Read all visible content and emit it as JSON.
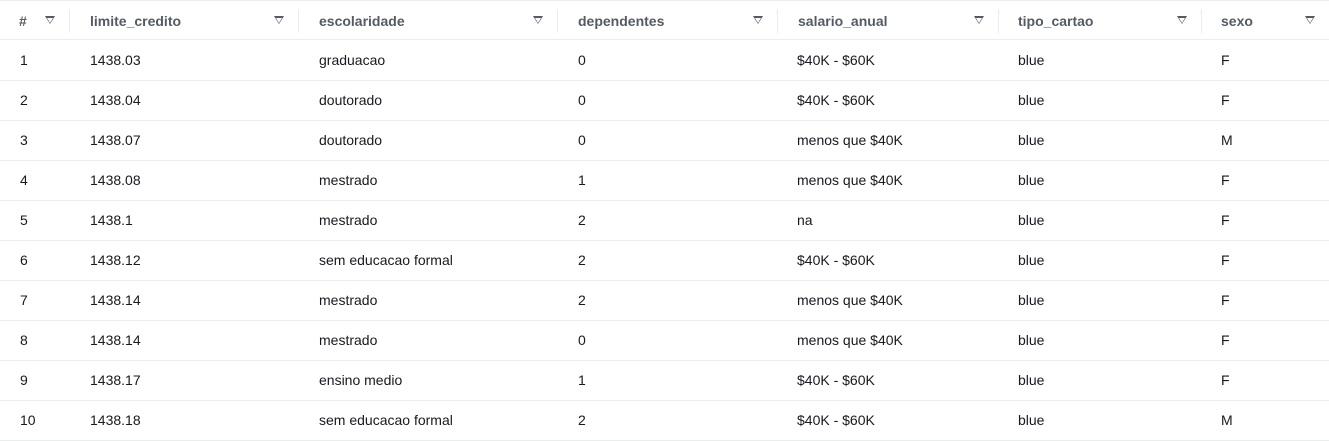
{
  "table": {
    "headers": [
      "#",
      "limite_credito",
      "escolaridade",
      "dependentes",
      "salario_anual",
      "tipo_cartao",
      "sexo"
    ],
    "rows": [
      [
        "1",
        "1438.03",
        "graduacao",
        "0",
        "$40K - $60K",
        "blue",
        "F"
      ],
      [
        "2",
        "1438.04",
        "doutorado",
        "0",
        "$40K - $60K",
        "blue",
        "F"
      ],
      [
        "3",
        "1438.07",
        "doutorado",
        "0",
        "menos que $40K",
        "blue",
        "M"
      ],
      [
        "4",
        "1438.08",
        "mestrado",
        "1",
        "menos que $40K",
        "blue",
        "F"
      ],
      [
        "5",
        "1438.1",
        "mestrado",
        "2",
        "na",
        "blue",
        "F"
      ],
      [
        "6",
        "1438.12",
        "sem educacao formal",
        "2",
        "$40K - $60K",
        "blue",
        "F"
      ],
      [
        "7",
        "1438.14",
        "mestrado",
        "2",
        "menos que $40K",
        "blue",
        "F"
      ],
      [
        "8",
        "1438.14",
        "mestrado",
        "0",
        "menos que $40K",
        "blue",
        "F"
      ],
      [
        "9",
        "1438.17",
        "ensino medio",
        "1",
        "$40K - $60K",
        "blue",
        "F"
      ],
      [
        "10",
        "1438.18",
        "sem educacao formal",
        "2",
        "$40K - $60K",
        "blue",
        "M"
      ]
    ]
  },
  "icons": {
    "sort": "sort-descending-icon"
  },
  "colors": {
    "header_text": "#545b64",
    "cell_text": "#16191f",
    "row_border": "#eaeded"
  }
}
